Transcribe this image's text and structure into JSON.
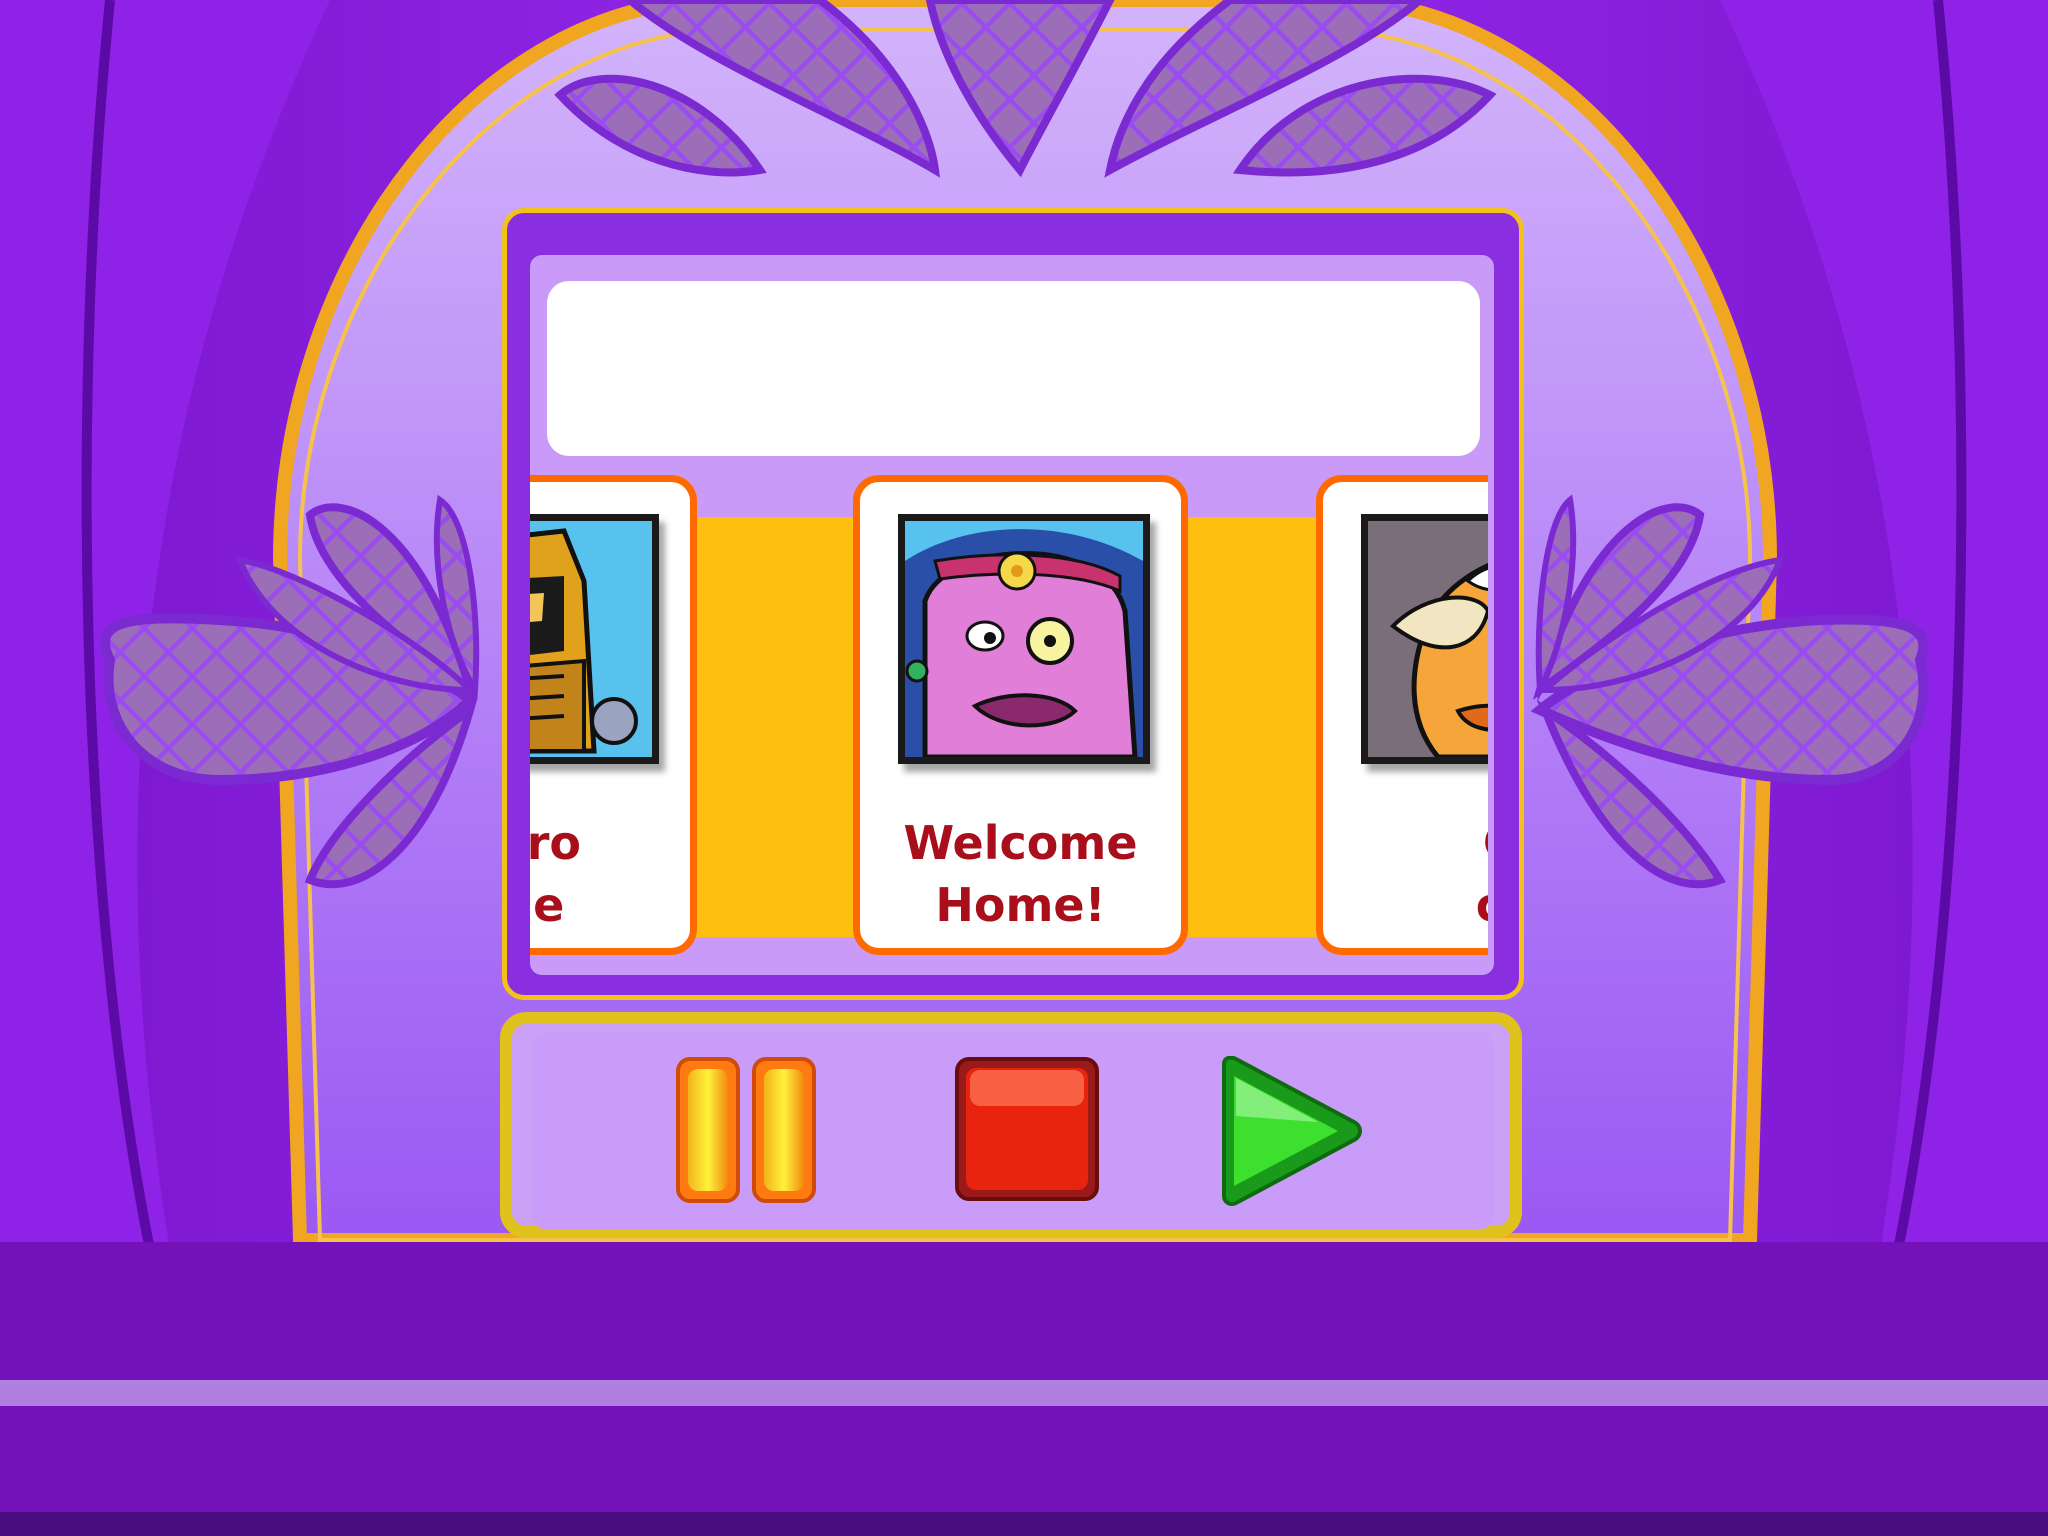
{
  "app": {
    "name": ""
  },
  "title_box": {
    "text": ""
  },
  "carousel": {
    "cards": [
      {
        "label": "Hero\nside",
        "character": "armored knight"
      },
      {
        "label": "Welcome\nHome!",
        "character": "pink furry lady with glasses"
      },
      {
        "label": "Cack,\ncacka",
        "character": "orange rhino"
      }
    ],
    "selected_index": 1
  },
  "controls": {
    "pause_icon": "pause-icon",
    "stop_icon": "stop-icon",
    "play_icon": "play-icon"
  },
  "colors": {
    "curtain": "#8a1fe0",
    "frame_gold": "#f2c21a",
    "card_border": "#ff6a00",
    "card_band": "#ffbf10",
    "label_text": "#a80f1a",
    "floor": "#7412b9"
  }
}
